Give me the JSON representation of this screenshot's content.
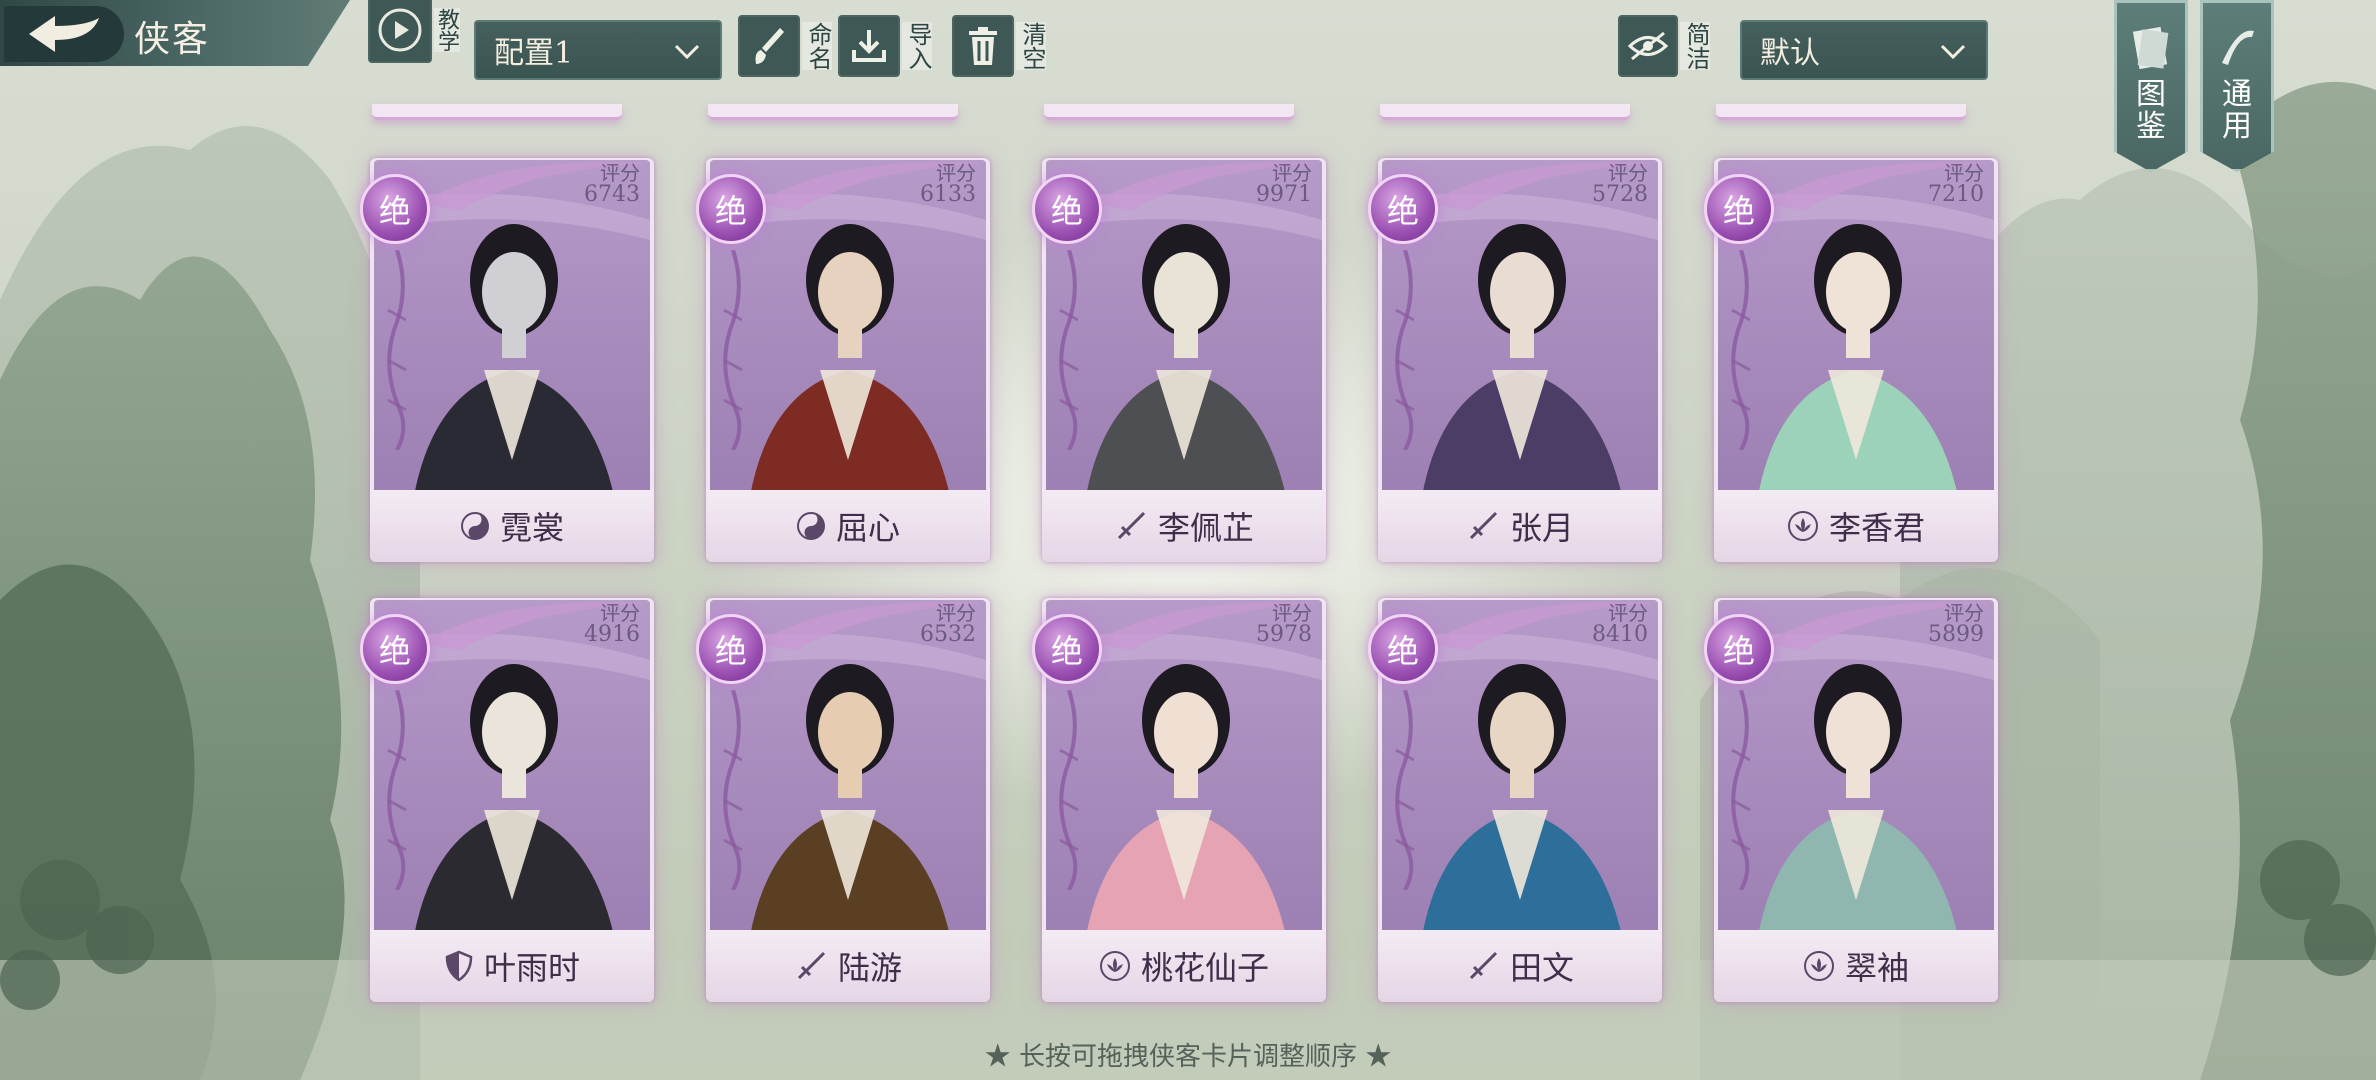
{
  "header": {
    "title": "侠客",
    "tutorial_label": "教学",
    "preset_value": "配置1",
    "rename_label": "命名",
    "import_label": "导入",
    "clear_label": "清空",
    "concise_label": "简洁",
    "sort_value": "默认",
    "atlas_label": "图鉴",
    "common_label": "通用"
  },
  "cards": [
    {
      "name": "霓裳",
      "rank": "绝",
      "score_label": "评分",
      "score": "6743",
      "faction": "taiji-icon"
    },
    {
      "name": "屈心",
      "rank": "绝",
      "score_label": "评分",
      "score": "6133",
      "faction": "taiji-icon"
    },
    {
      "name": "李佩芷",
      "rank": "绝",
      "score_label": "评分",
      "score": "9971",
      "faction": "sword-icon"
    },
    {
      "name": "张月",
      "rank": "绝",
      "score_label": "评分",
      "score": "5728",
      "faction": "sword-icon"
    },
    {
      "name": "李香君",
      "rank": "绝",
      "score_label": "评分",
      "score": "7210",
      "faction": "lotus-icon"
    },
    {
      "name": "叶雨时",
      "rank": "绝",
      "score_label": "评分",
      "score": "4916",
      "faction": "shield-icon"
    },
    {
      "name": "陆游",
      "rank": "绝",
      "score_label": "评分",
      "score": "6532",
      "faction": "sword-icon"
    },
    {
      "name": "桃花仙子",
      "rank": "绝",
      "score_label": "评分",
      "score": "5978",
      "faction": "lotus-icon"
    },
    {
      "name": "田文",
      "rank": "绝",
      "score_label": "评分",
      "score": "8410",
      "faction": "sword-icon"
    },
    {
      "name": "翠袖",
      "rank": "绝",
      "score_label": "评分",
      "score": "5899",
      "faction": "lotus-icon"
    }
  ],
  "footer": {
    "hint": "★ 长按可拖拽侠客卡片调整顺序 ★"
  },
  "colors": {
    "card_bg": "#a88cbd",
    "rank_badge": "#9a4fb2",
    "toolbar": "#3d5855"
  }
}
